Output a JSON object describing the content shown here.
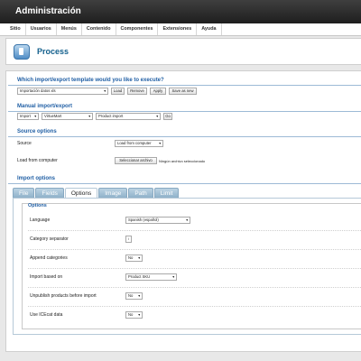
{
  "app": {
    "title": "Administración"
  },
  "menu": [
    "Sitio",
    "Usuarios",
    "Menús",
    "Contenido",
    "Componentes",
    "Extensiones",
    "Ayuda"
  ],
  "toolbar": {
    "title": "Process",
    "icon": "process-icon"
  },
  "template_section": {
    "title": "Which import/export template would you like to execute?",
    "select_value": "Importación datos xls",
    "buttons": [
      "Load",
      "Remove",
      "Apply",
      "Save as new"
    ]
  },
  "manual_section": {
    "title": "Manual import/export",
    "action": "Import",
    "component": "VirtueMart",
    "type": "Product import",
    "go_label": "Go"
  },
  "source_section": {
    "title": "Source options",
    "source_label": "Source",
    "source_value": "Load from computer",
    "file_label": "Load from computer",
    "file_button": "Seleccionar archivo",
    "file_status": "Ningún archivo seleccionado"
  },
  "import_section": {
    "title": "Import options",
    "tabs": [
      "File",
      "Fields",
      "Options",
      "Image",
      "Path",
      "Limit"
    ],
    "active_tab": "Options"
  },
  "options": {
    "legend": "Options",
    "language_label": "Language",
    "language_value": "Spanish (español)",
    "category_sep_label": "Category separator",
    "category_sep_value": "/",
    "append_label": "Append categories",
    "append_value": "No",
    "import_based_label": "Import based on",
    "import_based_value": "Product SKU",
    "unpublish_label": "Unpublish products before import",
    "unpublish_value": "No",
    "icecat_label": "Use ICEcat data",
    "icecat_value": "No"
  }
}
